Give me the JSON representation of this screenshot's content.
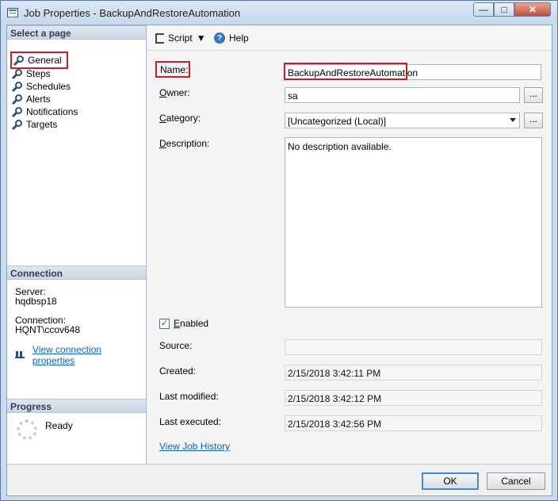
{
  "window": {
    "title": "Job Properties - BackupAndRestoreAutomation",
    "controls": [
      "—",
      "□",
      "✕"
    ]
  },
  "left_panel": {
    "select_page_label": "Select a page",
    "pages": [
      "General",
      "Steps",
      "Schedules",
      "Alerts",
      "Notifications",
      "Targets"
    ],
    "connection_label": "Connection",
    "server_label": "Server:",
    "server_value": "hqdbsp18",
    "connection_value_label": "Connection:",
    "connection_value": "HQNT\\ccov648",
    "view_connection_properties": "View connection properties",
    "progress_label": "Progress",
    "progress_status": "Ready"
  },
  "toolbar": {
    "script_label": "Script",
    "help_label": "Help"
  },
  "form": {
    "name_label": "Name:",
    "name_value": "BackupAndRestoreAutomation",
    "owner_label": "Owner:",
    "owner_value": "sa",
    "category_label": "Category:",
    "category_value": "[Uncategorized (Local)]",
    "description_label": "Description:",
    "description_value": "No description available.",
    "enabled_label": "Enabled",
    "source_label": "Source:",
    "source_value": "",
    "created_label": "Created:",
    "created_value": "2/15/2018 3:42:11 PM",
    "last_modified_label": "Last modified:",
    "last_modified_value": "2/15/2018 3:42:12 PM",
    "last_executed_label": "Last executed:",
    "last_executed_value": "2/15/2018 3:42:56 PM",
    "history_link": "View Job History"
  },
  "buttons": {
    "ellipsis": "...",
    "ok": "OK",
    "cancel": "Cancel"
  },
  "colors": {
    "highlight_red": "#c91e2a",
    "link_blue": "#0b63c8",
    "window_blue": "#c9dbef"
  },
  "icons": {
    "app": "app-icon",
    "page": "wrench-icon",
    "script": "script-icon",
    "help": "help-icon",
    "connection": "plug-icon",
    "progress": "progress-spinner-icon"
  }
}
